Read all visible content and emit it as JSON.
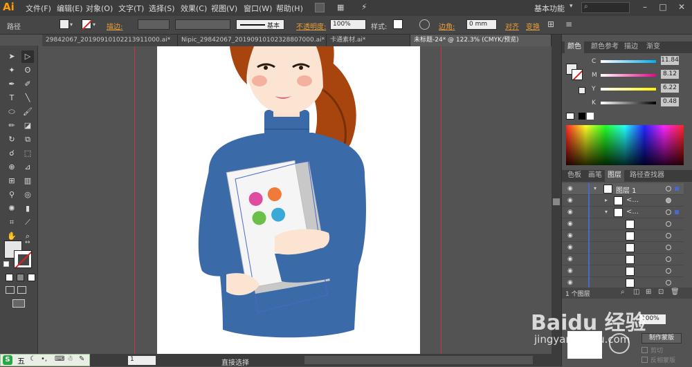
{
  "app": {
    "logo": "Ai"
  },
  "menu": [
    "文件(F)",
    "编辑(E)",
    "对象(O)",
    "文字(T)",
    "选择(S)",
    "效果(C)",
    "视图(V)",
    "窗口(W)",
    "帮助(H)"
  ],
  "workspace": {
    "label": "基本功能"
  },
  "control": {
    "path_label": "路径",
    "stroke_label": "描边:",
    "brush_label": "基本",
    "opacity_label": "不透明度:",
    "opacity_value": "100%",
    "style_label": "样式:",
    "corner_label": "边角:",
    "corner_value": "0 mm",
    "align_label": "对齐",
    "transform_label": "变换"
  },
  "tabs": [
    {
      "label": "29842067_20190910102213911000.ai*",
      "active": false
    },
    {
      "label": "Nipic_29842067_20190910102328807000.ai*",
      "active": false
    },
    {
      "label": "卡通素材.ai*",
      "active": false
    },
    {
      "label": "未标题-24* @ 122.3% (CMYK/预览)",
      "active": true
    }
  ],
  "color_panel": {
    "tabs": [
      "颜色",
      "颜色参考",
      "描边",
      "渐变"
    ],
    "sliders": [
      {
        "name": "C",
        "value": "11.84"
      },
      {
        "name": "M",
        "value": "8.12"
      },
      {
        "name": "Y",
        "value": "6.22"
      },
      {
        "name": "K",
        "value": "0.48"
      }
    ]
  },
  "layers_panel": {
    "tabs": [
      "色板",
      "画笔",
      "图层",
      "路径查找器"
    ],
    "top_layer": "图层 1",
    "sublayer_label": "<...",
    "footer": "1 个图层"
  },
  "transparency": {
    "opacity_value": "100%",
    "make_mask": "制作蒙版",
    "clip": "剪切",
    "invert_mask": "反相蒙版"
  },
  "status": {
    "zoom_value": "1",
    "tool_name": "直接选择"
  },
  "watermark": {
    "brand": "Baidu 经验",
    "url": "jingyan.baidu.com"
  },
  "taskbar": {
    "label": "五"
  },
  "colors": {
    "shirt": "#3a6aa8",
    "hair": "#a8450f",
    "skin": "#fce4d2",
    "accent": "#e8a03a",
    "guide": "#c8353a"
  }
}
